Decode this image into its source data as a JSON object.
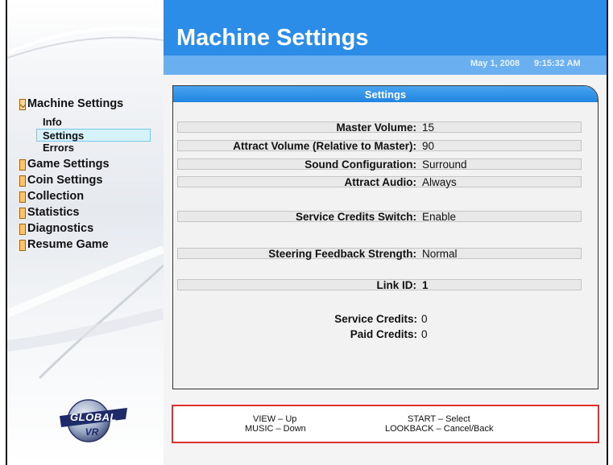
{
  "header": {
    "title": "Machine Settings",
    "date": "May 1, 2008",
    "time": "9:15:32 AM"
  },
  "sidebar": {
    "items": [
      {
        "label": "Machine Settings"
      },
      {
        "label": "Game Settings"
      },
      {
        "label": "Coin Settings"
      },
      {
        "label": "Collection"
      },
      {
        "label": "Statistics"
      },
      {
        "label": "Diagnostics"
      },
      {
        "label": "Resume Game"
      }
    ],
    "subitems": [
      {
        "label": "Info"
      },
      {
        "label": "Settings"
      },
      {
        "label": "Errors"
      }
    ],
    "logo_text": "GLOBAL VR"
  },
  "panel": {
    "title": "Settings",
    "rows": [
      {
        "key": "Master Volume:",
        "value": "15"
      },
      {
        "key": "Attract Volume (Relative to Master):",
        "value": "90"
      },
      {
        "key": "Sound Configuration:",
        "value": "Surround"
      },
      {
        "key": "Attract Audio:",
        "value": "Always"
      },
      {
        "key": "Service Credits Switch:",
        "value": "Enable"
      },
      {
        "key": "Steering Feedback Strength:",
        "value": "Normal"
      },
      {
        "key": "Link ID:",
        "value": "1"
      },
      {
        "key": "Service Credits:",
        "value": "0"
      },
      {
        "key": "Paid Credits:",
        "value": "0"
      }
    ]
  },
  "help": {
    "view": "VIEW – Up",
    "music": "MUSIC – Down",
    "start": "START – Select",
    "lookback": "LOOKBACK – Cancel/Back"
  },
  "colors": {
    "header": "#2c8de8",
    "datebar": "#6ab0f0",
    "help_border": "#e03030",
    "selected_bg": "#d6f2fb"
  }
}
